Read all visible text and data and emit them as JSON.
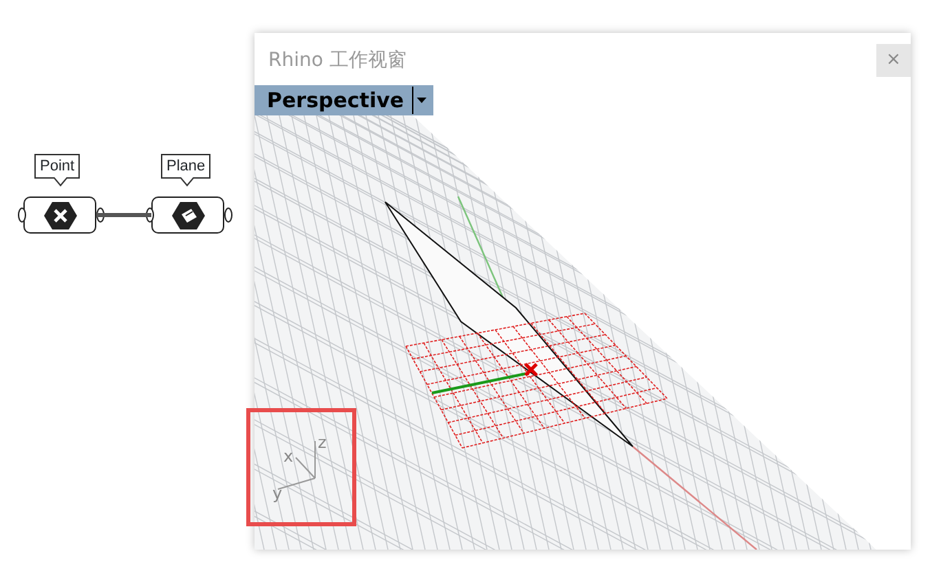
{
  "canvas": {
    "nodes": [
      {
        "label": "Point",
        "kind": "point"
      },
      {
        "label": "Plane",
        "kind": "plane"
      }
    ]
  },
  "window": {
    "title": "Rhino 工作视窗",
    "close": "×"
  },
  "viewport": {
    "label": "Perspective",
    "axis_labels": {
      "z": "z",
      "x": "x",
      "y": "y"
    },
    "highlight": true
  }
}
